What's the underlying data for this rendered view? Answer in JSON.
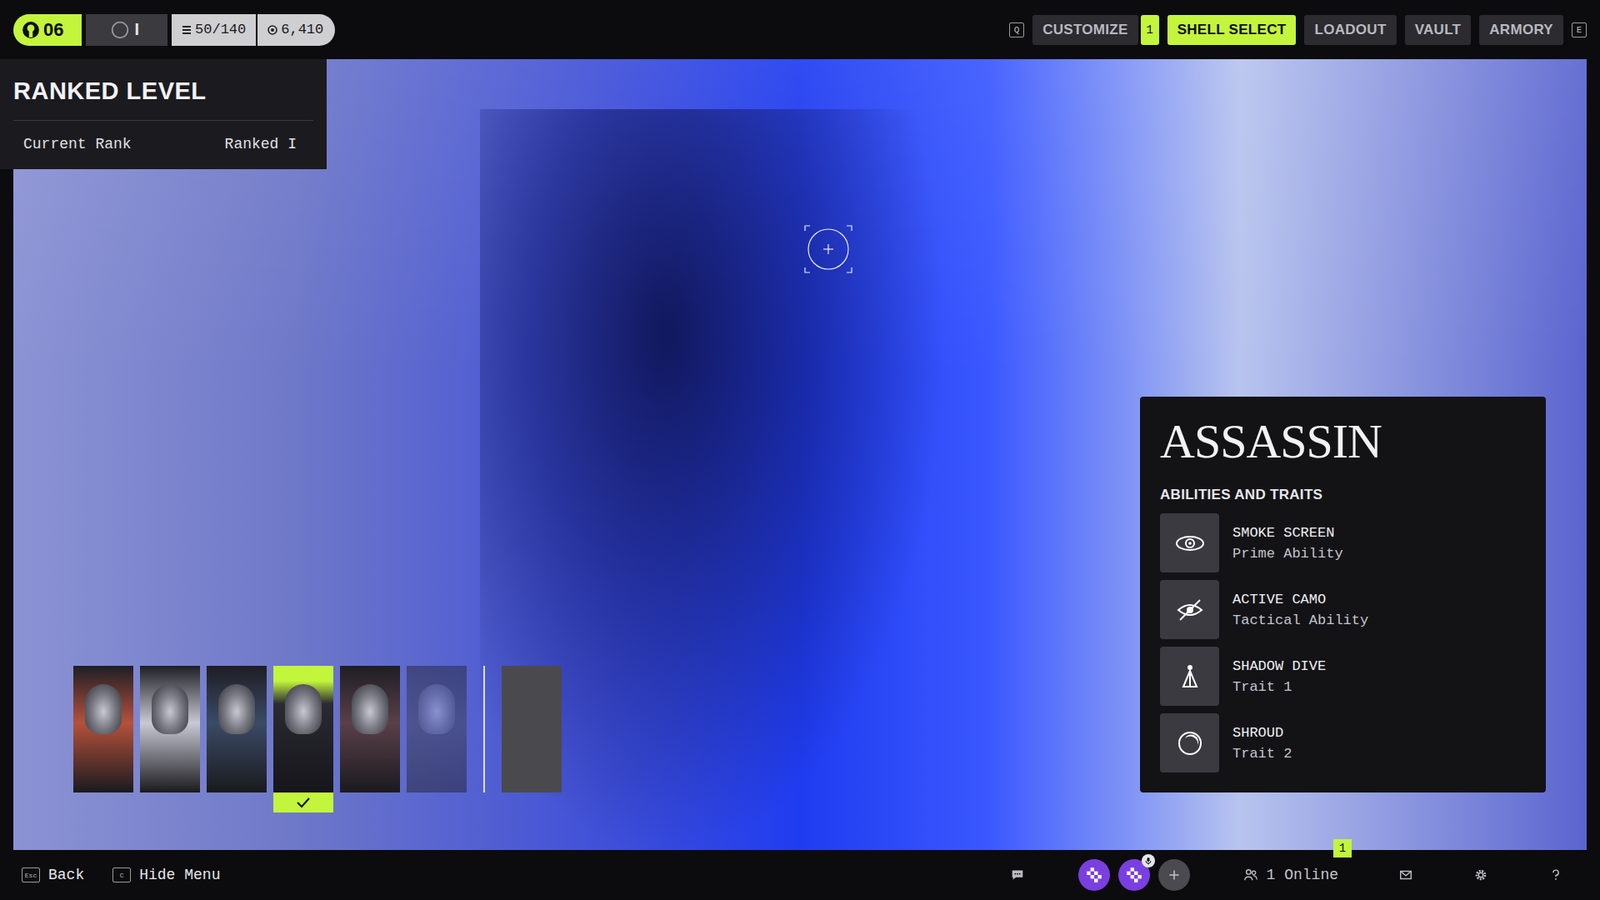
{
  "top_bar": {
    "level": "06",
    "rank": "I",
    "capacity": "50/140",
    "credits": "6,410",
    "left_key": "Q",
    "right_key": "E",
    "tabs": [
      {
        "label": "CUSTOMIZE",
        "selected": false,
        "badge": "1"
      },
      {
        "label": "SHELL SELECT",
        "selected": true,
        "badge": ""
      },
      {
        "label": "LOADOUT",
        "selected": false,
        "badge": ""
      },
      {
        "label": "VAULT",
        "selected": false,
        "badge": ""
      },
      {
        "label": "ARMORY",
        "selected": false,
        "badge": ""
      }
    ]
  },
  "tooltip": {
    "title": "RANKED LEVEL",
    "rows": [
      {
        "label": "Current Rank",
        "value": "Ranked I"
      }
    ]
  },
  "shells": [
    {
      "kind": "shell",
      "selected": false,
      "dimmed": false,
      "color": "#b4513c"
    },
    {
      "kind": "shell",
      "selected": false,
      "dimmed": false,
      "color": "#c9c9d4"
    },
    {
      "kind": "shell",
      "selected": false,
      "dimmed": false,
      "color": "#3b4a66"
    },
    {
      "kind": "shell",
      "selected": true,
      "dimmed": false,
      "color": "#2a2a32"
    },
    {
      "kind": "shell",
      "selected": false,
      "dimmed": false,
      "color": "#5a4048"
    },
    {
      "kind": "shell",
      "selected": false,
      "dimmed": true,
      "color": "#3c3c40"
    },
    {
      "kind": "empty",
      "selected": false,
      "dimmed": false,
      "color": "#4a4a4e"
    }
  ],
  "shell_panel": {
    "name": "ASSASSIN",
    "section": "ABILITIES AND TRAITS",
    "abilities": [
      {
        "name": "SMOKE SCREEN",
        "type": "Prime Ability"
      },
      {
        "name": "ACTIVE CAMO",
        "type": "Tactical Ability"
      },
      {
        "name": "SHADOW DIVE",
        "type": "Trait 1"
      },
      {
        "name": "SHROUD",
        "type": "Trait 2"
      }
    ]
  },
  "bottom_bar": {
    "actions": [
      {
        "key": "Esc",
        "label": "Back"
      },
      {
        "key": "C",
        "label": "Hide Menu"
      }
    ],
    "party": [
      {
        "kind": "member",
        "color": "#7a3fe0",
        "mic": false
      },
      {
        "kind": "member",
        "color": "#7a3fe0",
        "mic": true
      },
      {
        "kind": "invite",
        "color": "#4a4a50",
        "mic": false
      }
    ],
    "online": "1 Online",
    "online_badge": "1"
  }
}
